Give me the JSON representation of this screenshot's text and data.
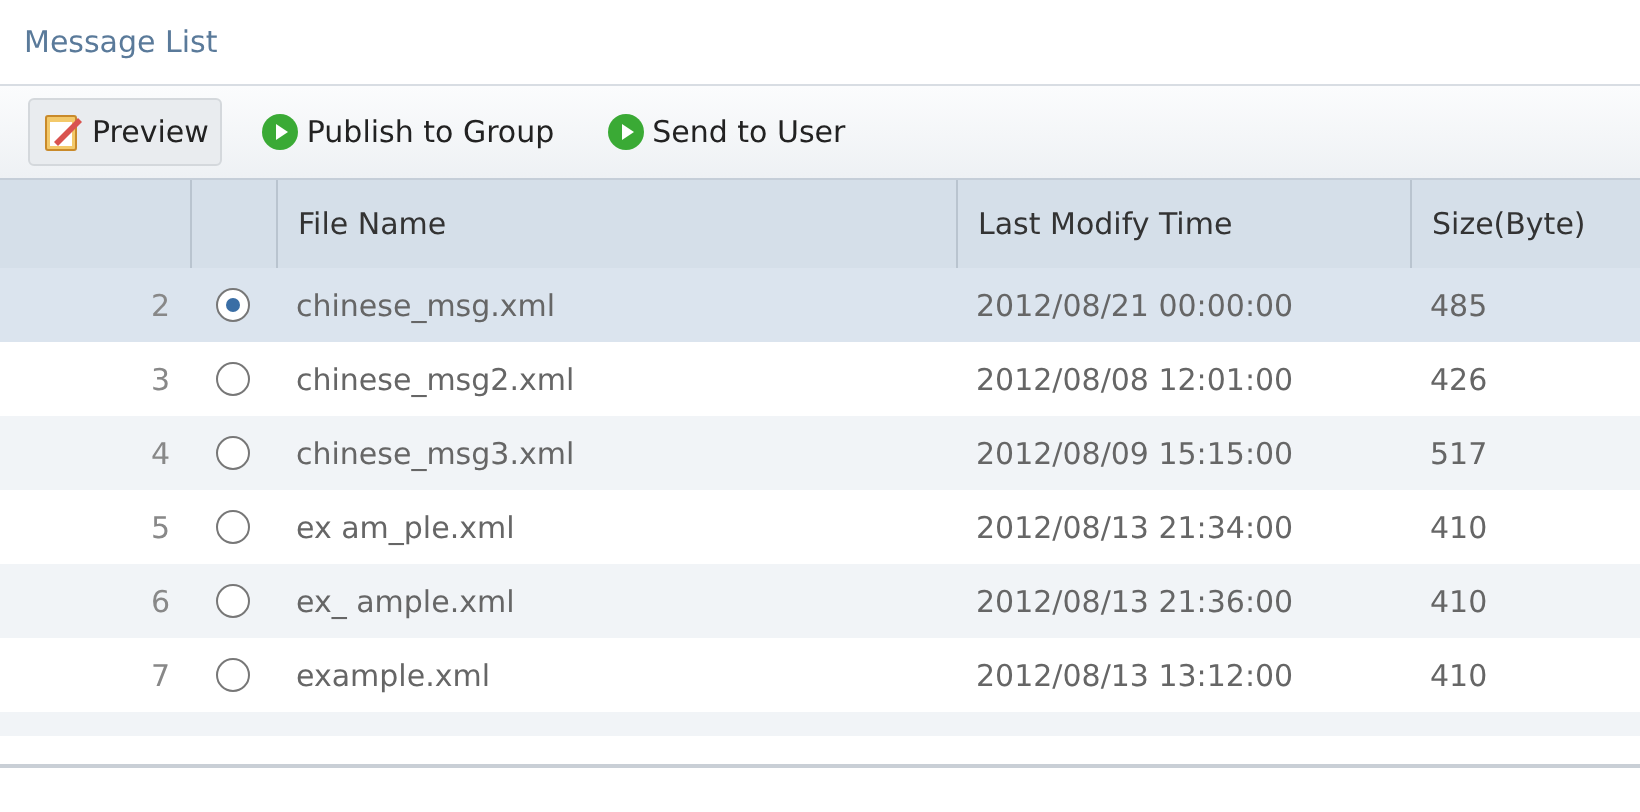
{
  "panel": {
    "title": "Message List"
  },
  "toolbar": [
    {
      "kind": "preview",
      "label": "Preview"
    },
    {
      "kind": "play",
      "label": "Publish to Group"
    },
    {
      "kind": "play",
      "label": "Send to User"
    }
  ],
  "table": {
    "columns": [
      "File Name",
      "Last Modify Time",
      "Size(Byte)"
    ],
    "rows": [
      {
        "number": "2",
        "selected": true,
        "file": "chinese_msg.xml",
        "time": "2012/08/21 00:00:00",
        "size": "485"
      },
      {
        "number": "3",
        "selected": false,
        "file": "chinese_msg2.xml",
        "time": "2012/08/08 12:01:00",
        "size": "426"
      },
      {
        "number": "4",
        "selected": false,
        "file": "chinese_msg3.xml",
        "time": "2012/08/09 15:15:00",
        "size": "517"
      },
      {
        "number": "5",
        "selected": false,
        "file": "ex am_ple.xml",
        "time": "2012/08/13 21:34:00",
        "size": "410"
      },
      {
        "number": "6",
        "selected": false,
        "file": "ex_ ample.xml",
        "time": "2012/08/13 21:36:00",
        "size": "410"
      },
      {
        "number": "7",
        "selected": false,
        "file": "example.xml",
        "time": "2012/08/13 13:12:00",
        "size": "410"
      }
    ]
  }
}
